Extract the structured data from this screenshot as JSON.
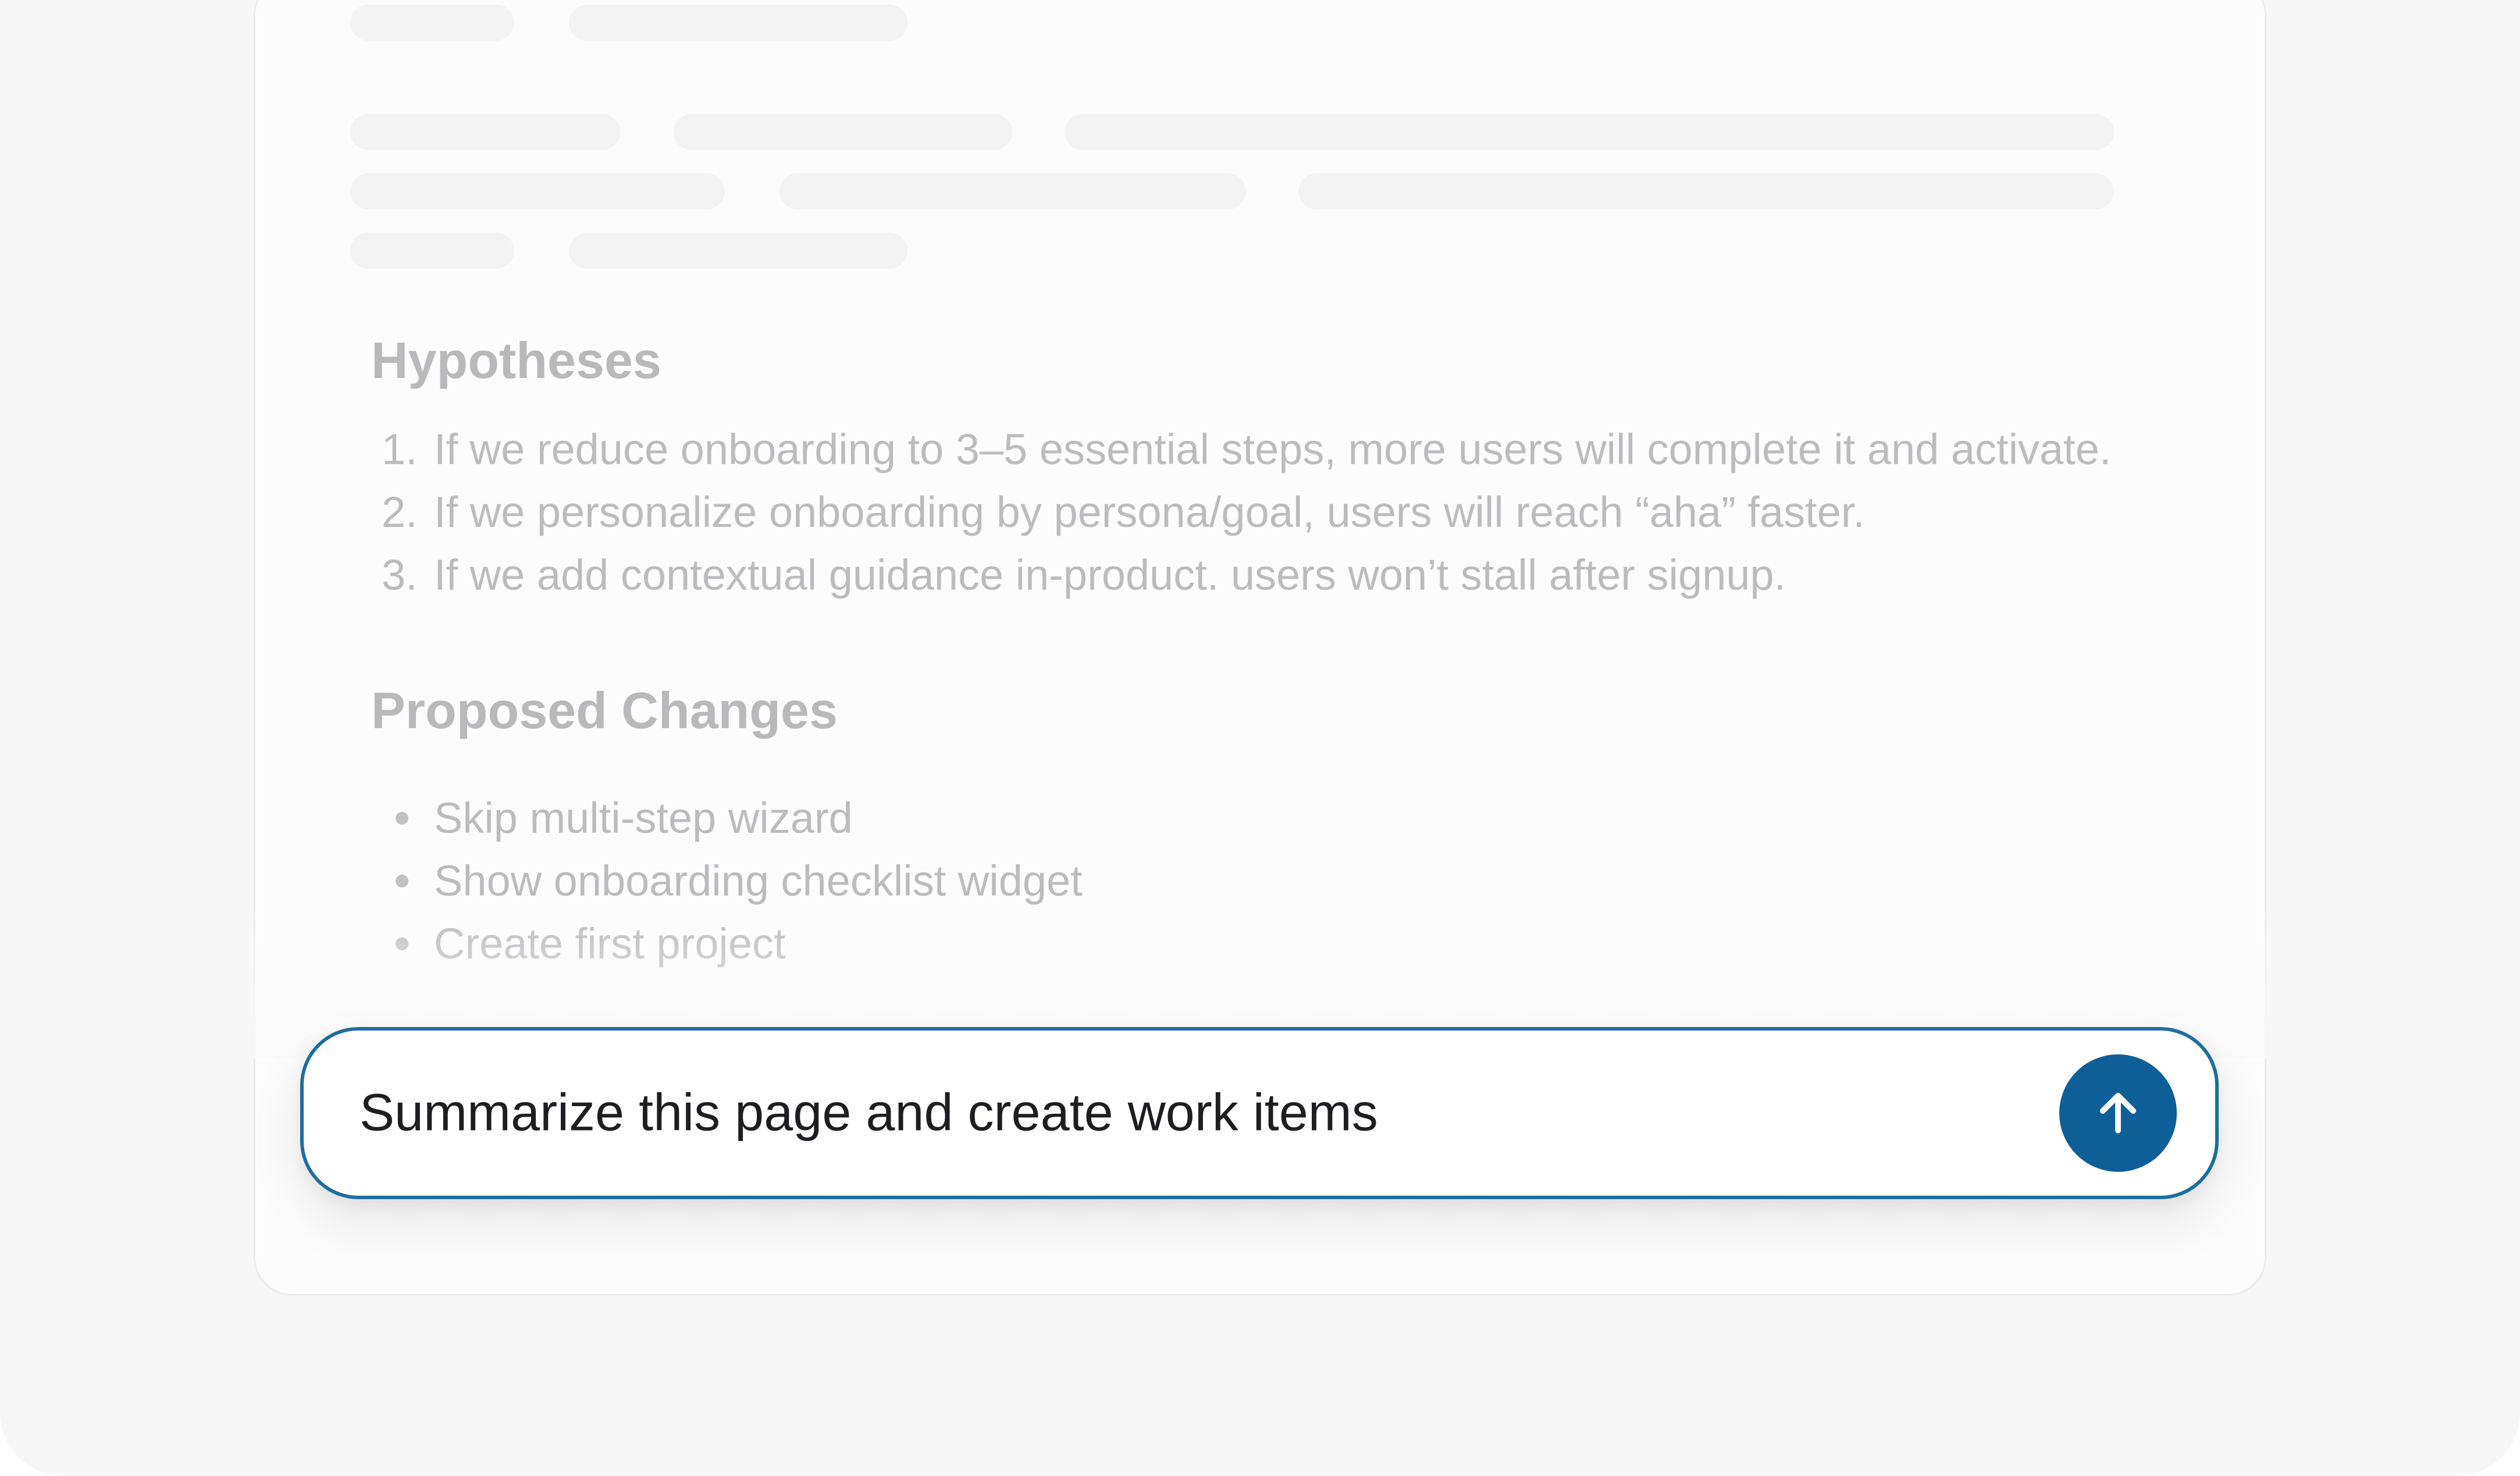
{
  "document": {
    "sections": [
      {
        "title": "Hypotheses",
        "list_type": "ordered",
        "items": [
          {
            "marker": "1.",
            "text": "If we reduce onboarding to 3–5 essential steps, more users will complete it and activate."
          },
          {
            "marker": "2.",
            "text": "If we personalize onboarding by persona/goal, users will reach “aha” faster."
          },
          {
            "marker": "3.",
            "text": "If we add contextual guidance in-product. users won’t stall after signup."
          }
        ]
      },
      {
        "title": "Proposed Changes",
        "list_type": "bulleted",
        "items": [
          {
            "text": "Skip multi-step wizard"
          },
          {
            "text": "Show onboarding checklist widget"
          },
          {
            "text": "Create first project"
          }
        ]
      }
    ]
  },
  "prompt": {
    "value": "Summarize this page and create work items",
    "accent_color": "#1d6e9e"
  },
  "send_button": {
    "icon": "arrow-up-icon",
    "color": "#0e5f98"
  },
  "colors": {
    "muted_text": "#bcbcbf",
    "skeleton": "#f3f3f4",
    "prompt_text": "#1e1e22"
  }
}
